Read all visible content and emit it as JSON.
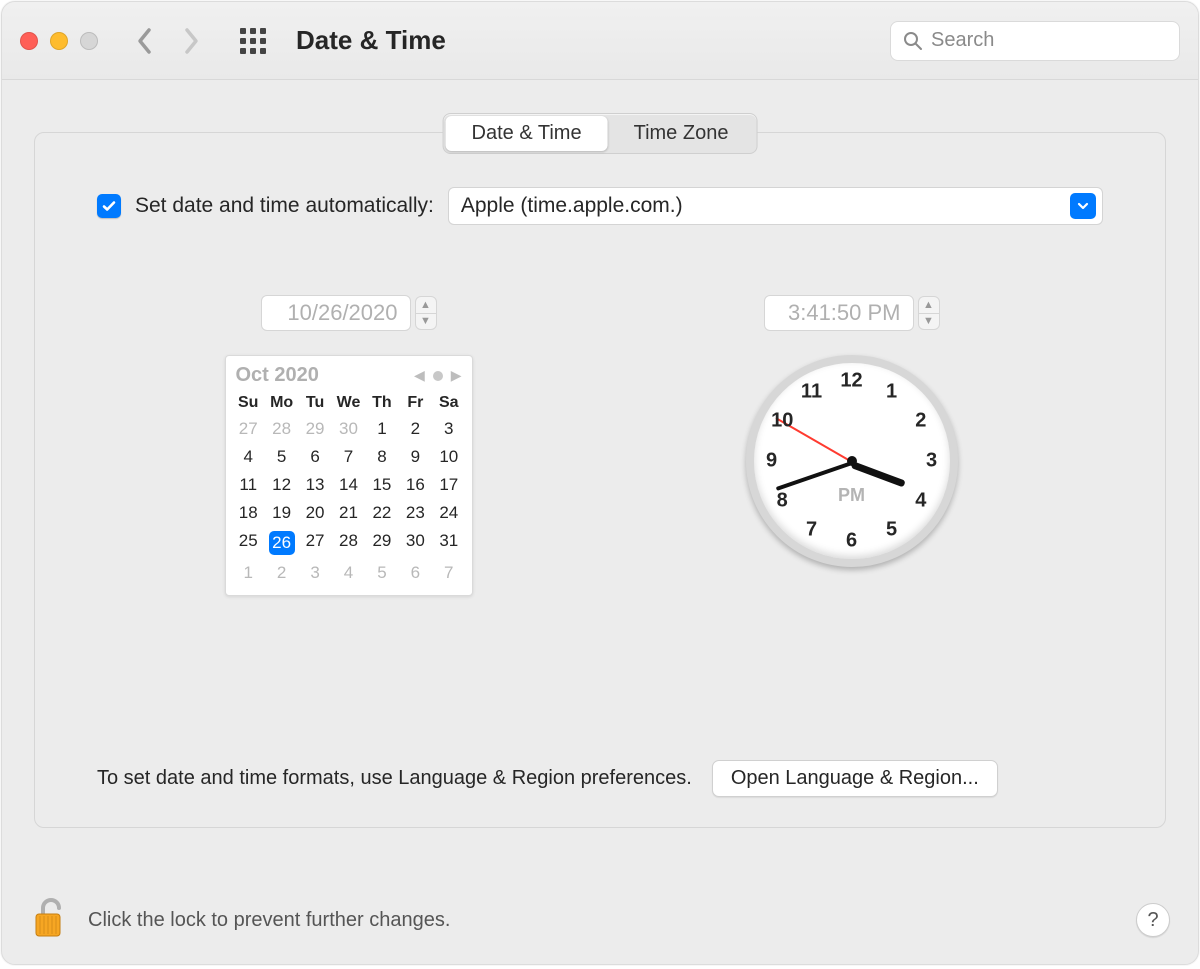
{
  "window": {
    "title": "Date & Time"
  },
  "toolbar": {
    "search_placeholder": "Search"
  },
  "tabs": {
    "date_time": "Date & Time",
    "time_zone": "Time Zone",
    "active": "date_time"
  },
  "auto": {
    "checked": true,
    "label": "Set date and time automatically:",
    "server": "Apple (time.apple.com.)"
  },
  "date_field": "10/26/2020",
  "time_field": "3:41:50 PM",
  "calendar": {
    "title": "Oct 2020",
    "dows": [
      "Su",
      "Mo",
      "Tu",
      "We",
      "Th",
      "Fr",
      "Sa"
    ],
    "weeks": [
      [
        {
          "n": 27,
          "out": true
        },
        {
          "n": 28,
          "out": true
        },
        {
          "n": 29,
          "out": true
        },
        {
          "n": 30,
          "out": true
        },
        {
          "n": 1
        },
        {
          "n": 2
        },
        {
          "n": 3
        }
      ],
      [
        {
          "n": 4
        },
        {
          "n": 5
        },
        {
          "n": 6
        },
        {
          "n": 7
        },
        {
          "n": 8
        },
        {
          "n": 9
        },
        {
          "n": 10
        }
      ],
      [
        {
          "n": 11
        },
        {
          "n": 12
        },
        {
          "n": 13
        },
        {
          "n": 14
        },
        {
          "n": 15
        },
        {
          "n": 16
        },
        {
          "n": 17
        }
      ],
      [
        {
          "n": 18
        },
        {
          "n": 19
        },
        {
          "n": 20
        },
        {
          "n": 21
        },
        {
          "n": 22
        },
        {
          "n": 23
        },
        {
          "n": 24
        }
      ],
      [
        {
          "n": 25
        },
        {
          "n": 26,
          "sel": true
        },
        {
          "n": 27
        },
        {
          "n": 28
        },
        {
          "n": 29
        },
        {
          "n": 30
        },
        {
          "n": 31
        }
      ],
      [
        {
          "n": 1,
          "out": true
        },
        {
          "n": 2,
          "out": true
        },
        {
          "n": 3,
          "out": true
        },
        {
          "n": 4,
          "out": true
        },
        {
          "n": 5,
          "out": true
        },
        {
          "n": 6,
          "out": true
        },
        {
          "n": 7,
          "out": true
        }
      ]
    ]
  },
  "clock": {
    "ampm": "PM",
    "hours": 3,
    "minutes": 41,
    "seconds": 50,
    "numbers": [
      "12",
      "1",
      "2",
      "3",
      "4",
      "5",
      "6",
      "7",
      "8",
      "9",
      "10",
      "11"
    ]
  },
  "formats_hint": "To set date and time formats, use Language & Region preferences.",
  "open_lang_region": "Open Language & Region...",
  "footer": {
    "lock_text": "Click the lock to prevent further changes.",
    "help": "?"
  }
}
